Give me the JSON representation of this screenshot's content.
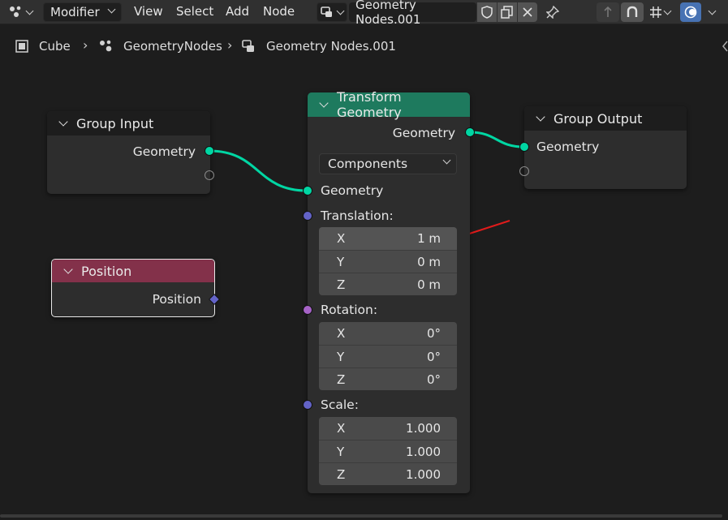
{
  "header": {
    "editor_type_icon": "node-editor-icon",
    "mode": "Modifier",
    "menus": [
      "View",
      "Select",
      "Add",
      "Node"
    ],
    "node_group_name": "Geometry Nodes.001"
  },
  "breadcrumb": {
    "object": "Cube",
    "modifier": "GeometryNodes",
    "node_group": "Geometry Nodes.001"
  },
  "nodes": {
    "group_input": {
      "title": "Group Input",
      "output_label": "Geometry",
      "header_color": "#1d1d1d"
    },
    "position": {
      "title": "Position",
      "output_label": "Position",
      "header_color": "#83314a"
    },
    "transform": {
      "title": "Transform Geometry",
      "header_color": "#1e7a5e",
      "output_label": "Geometry",
      "mode": "Components",
      "input_geometry": "Geometry",
      "translation": {
        "label": "Translation:",
        "x_label": "X",
        "x": "1 m",
        "y_label": "Y",
        "y": "0 m",
        "z_label": "Z",
        "z": "0 m"
      },
      "rotation": {
        "label": "Rotation:",
        "x_label": "X",
        "x": "0°",
        "y_label": "Y",
        "y": "0°",
        "z_label": "Z",
        "z": "0°"
      },
      "scale": {
        "label": "Scale:",
        "x_label": "X",
        "x": "1.000",
        "y_label": "Y",
        "y": "1.000",
        "z_label": "Z",
        "z": "1.000"
      }
    },
    "group_output": {
      "title": "Group Output",
      "input_label": "Geometry",
      "header_color": "#1d1d1d"
    }
  },
  "colors": {
    "geometry_socket": "#00d6a3",
    "vector_socket": "#6363c7",
    "rotation_socket": "#a663c7",
    "annotation_arrow": "#e01b1b",
    "accent_blue": "#4772b3"
  }
}
